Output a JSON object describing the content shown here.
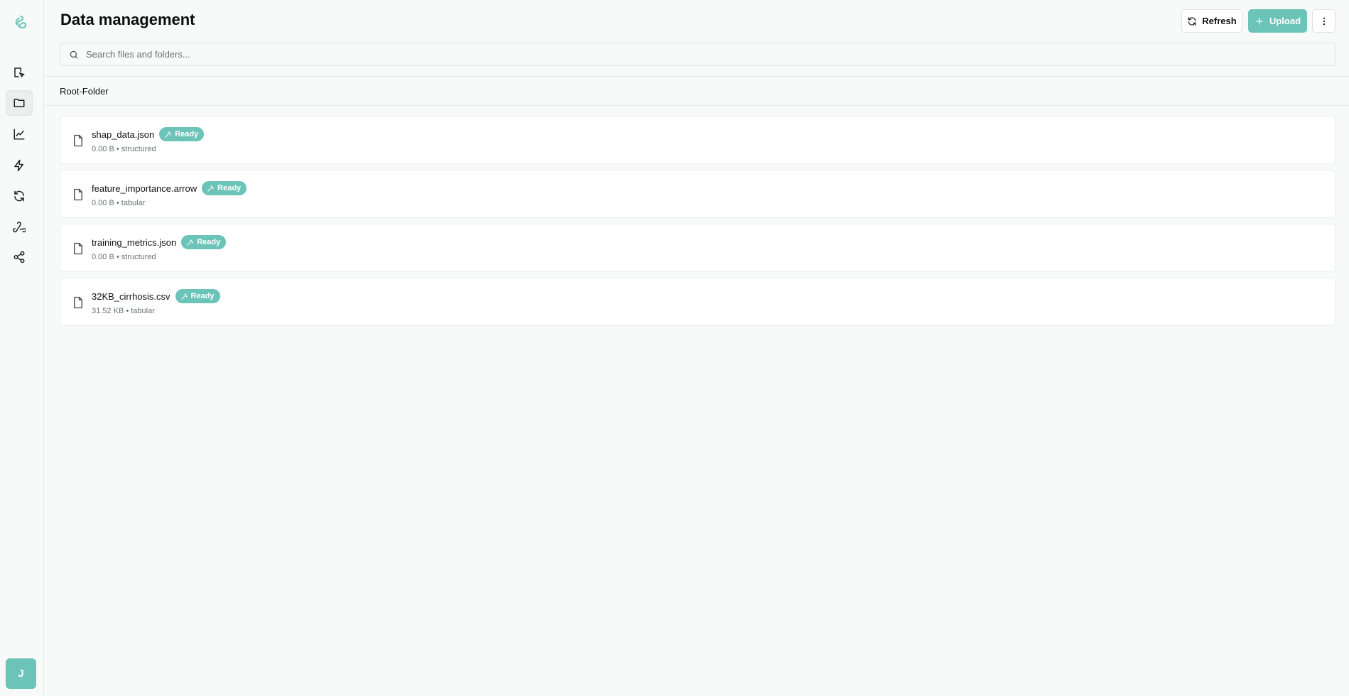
{
  "app": {
    "page_title": "Data management"
  },
  "sidebar": {
    "logo": "logo-icon",
    "items": [
      {
        "icon": "edit-icon",
        "label": "editor"
      },
      {
        "icon": "folder-icon",
        "label": "data"
      },
      {
        "icon": "line-chart-icon",
        "label": "analytics"
      },
      {
        "icon": "lightning-icon",
        "label": "actions"
      },
      {
        "icon": "refresh-cycle-icon",
        "label": "sync"
      },
      {
        "icon": "webhook-icon",
        "label": "webhooks"
      },
      {
        "icon": "share-icon",
        "label": "share"
      }
    ],
    "avatar_initial": "J"
  },
  "toolbar": {
    "refresh_label": "Refresh",
    "upload_label": "Upload",
    "more_icon": "more-vertical-icon"
  },
  "search": {
    "placeholder": "Search files and folders..."
  },
  "breadcrumb": {
    "root": "Root-Folder"
  },
  "files": [
    {
      "name": "shap_data.json",
      "status": "Ready",
      "size": "0.00 B",
      "kind": "structured",
      "meta": "0.00 B • structured"
    },
    {
      "name": "feature_importance.arrow",
      "status": "Ready",
      "size": "0.00 B",
      "kind": "tabular",
      "meta": "0.00 B • tabular"
    },
    {
      "name": "training_metrics.json",
      "status": "Ready",
      "size": "0.00 B",
      "kind": "structured",
      "meta": "0.00 B • structured"
    },
    {
      "name": "32KB_cirrhosis.csv",
      "status": "Ready",
      "size": "31.52 KB",
      "kind": "tabular",
      "meta": "31.52 KB • tabular"
    }
  ],
  "colors": {
    "accent": "#6cc3b8",
    "background": "#f8f9f9",
    "card": "#ffffff",
    "border": "#e6e8e8"
  }
}
